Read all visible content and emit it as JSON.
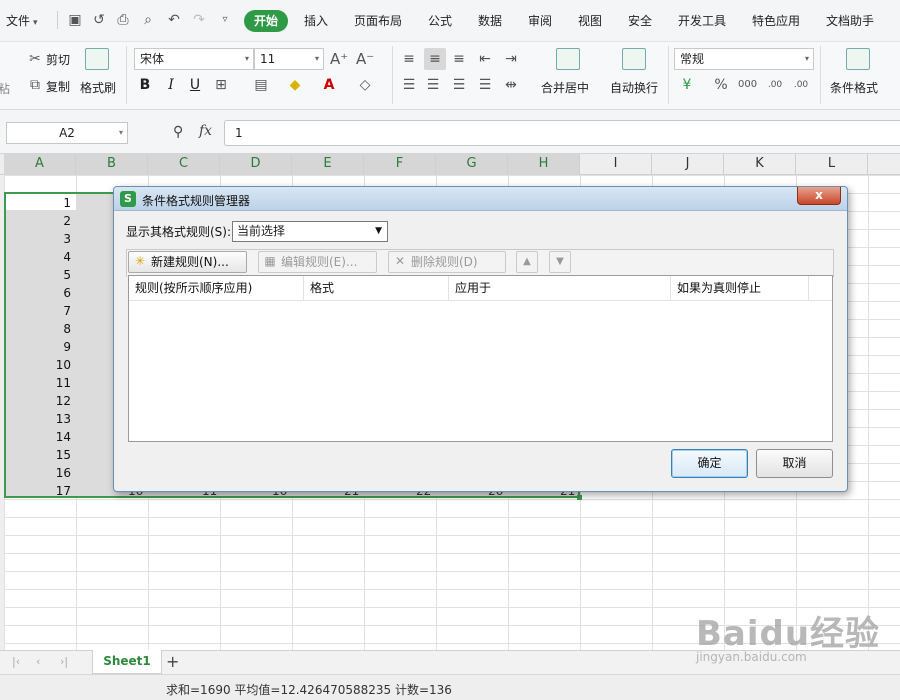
{
  "menu": {
    "file_label": "文件",
    "tabs": [
      {
        "label": "开始",
        "active": true
      },
      {
        "label": "插入"
      },
      {
        "label": "页面布局"
      },
      {
        "label": "公式"
      },
      {
        "label": "数据"
      },
      {
        "label": "审阅"
      },
      {
        "label": "视图"
      },
      {
        "label": "安全"
      },
      {
        "label": "开发工具"
      },
      {
        "label": "特色应用"
      },
      {
        "label": "文档助手"
      }
    ]
  },
  "ribbon": {
    "cut": "剪切",
    "copy": "复制",
    "format_painter": "格式刷",
    "font_name": "宋体",
    "font_size": "11",
    "merge_center": "合并居中",
    "wrap_text": "自动换行",
    "number_format": "常规",
    "conditional_format": "条件格式",
    "paste_partial": "粘"
  },
  "formula_bar": {
    "name_box": "A2",
    "fx": "fx",
    "value": "1"
  },
  "grid": {
    "columns": [
      "A",
      "B",
      "C",
      "D",
      "E",
      "F",
      "G",
      "H",
      "I",
      "J",
      "K",
      "L"
    ],
    "rows": [
      "1",
      "2",
      "3",
      "4",
      "5",
      "6",
      "7",
      "8",
      "9",
      "10",
      "11",
      "12",
      "13",
      "14",
      "15",
      "16",
      "17"
    ],
    "partial_row": [
      "16",
      "11",
      "16",
      "21",
      "22",
      "26",
      "21"
    ]
  },
  "sheets": {
    "active": "Sheet1",
    "add": "+"
  },
  "status": {
    "text": "求和=1690  平均值=12.426470588235  计数=136"
  },
  "dialog": {
    "title": "条件格式规则管理器",
    "app_icon": "S",
    "close": "x",
    "show_rules_label": "显示其格式规则(S):",
    "show_rules_value": "当前选择",
    "new_rule": "新建规则(N)...",
    "edit_rule": "编辑规则(E)...",
    "delete_rule": "删除规则(D)",
    "columns": [
      "规则(按所示顺序应用)",
      "格式",
      "应用于",
      "如果为真则停止"
    ],
    "ok": "确定",
    "cancel": "取消"
  },
  "watermark": {
    "main": "Baidu经验",
    "sub": "jingyan.baidu.com"
  },
  "colors": {
    "accent_green": "#2e9a46",
    "selection_border": "#3e9b4d"
  }
}
